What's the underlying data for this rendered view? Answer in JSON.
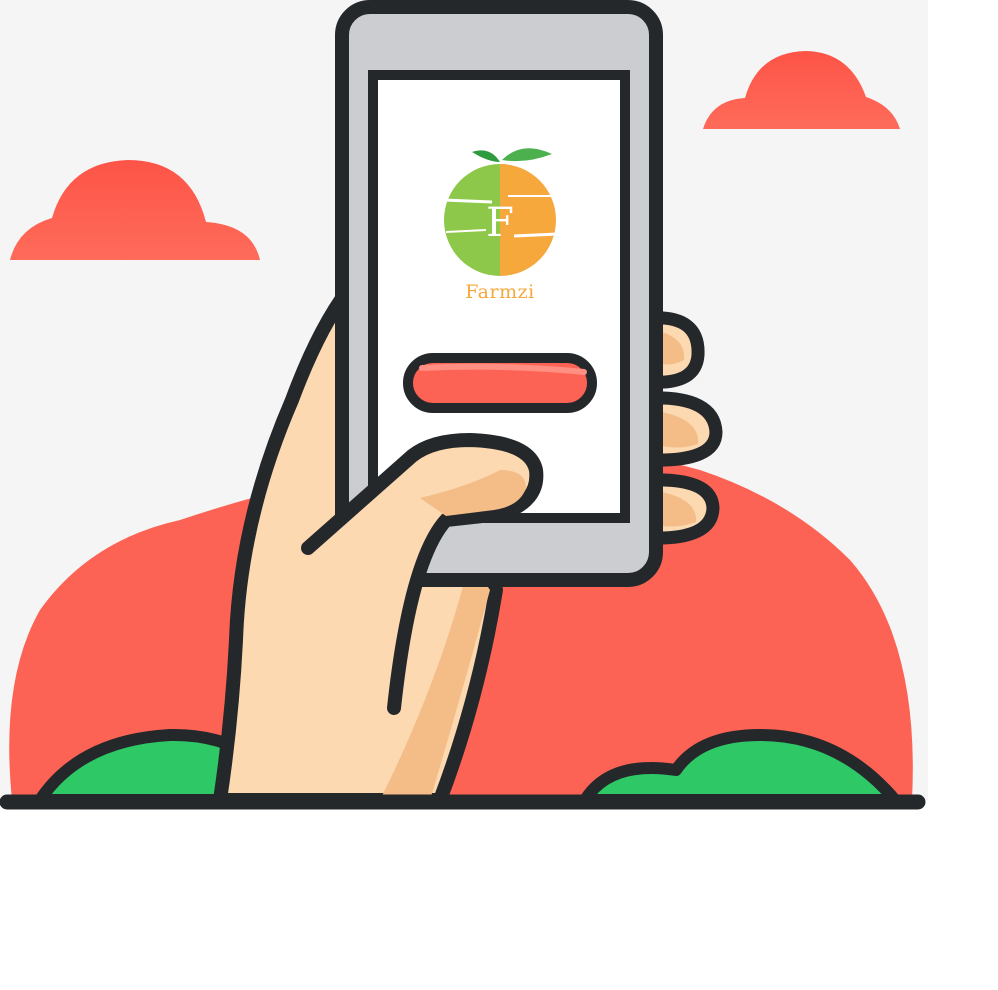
{
  "app": {
    "brand_name": "Farmzi",
    "logo_letter": "F"
  },
  "icons": {
    "logo": "farmzi-fruit-logo",
    "action_button": "red-pill-button"
  },
  "colors": {
    "background": "#f5f5f5",
    "cloud": "#fc5e52",
    "hill": "#fd6354",
    "bush": "#2ec866",
    "outline": "#25282b",
    "phone_body": "#cbcdd1",
    "screen": "#ffffff",
    "skin": "#fcd9b0",
    "skin_shade": "#f4bd87",
    "logo_green": "#8dc84a",
    "logo_orange": "#f6a83d",
    "button_red": "#fd6354"
  }
}
